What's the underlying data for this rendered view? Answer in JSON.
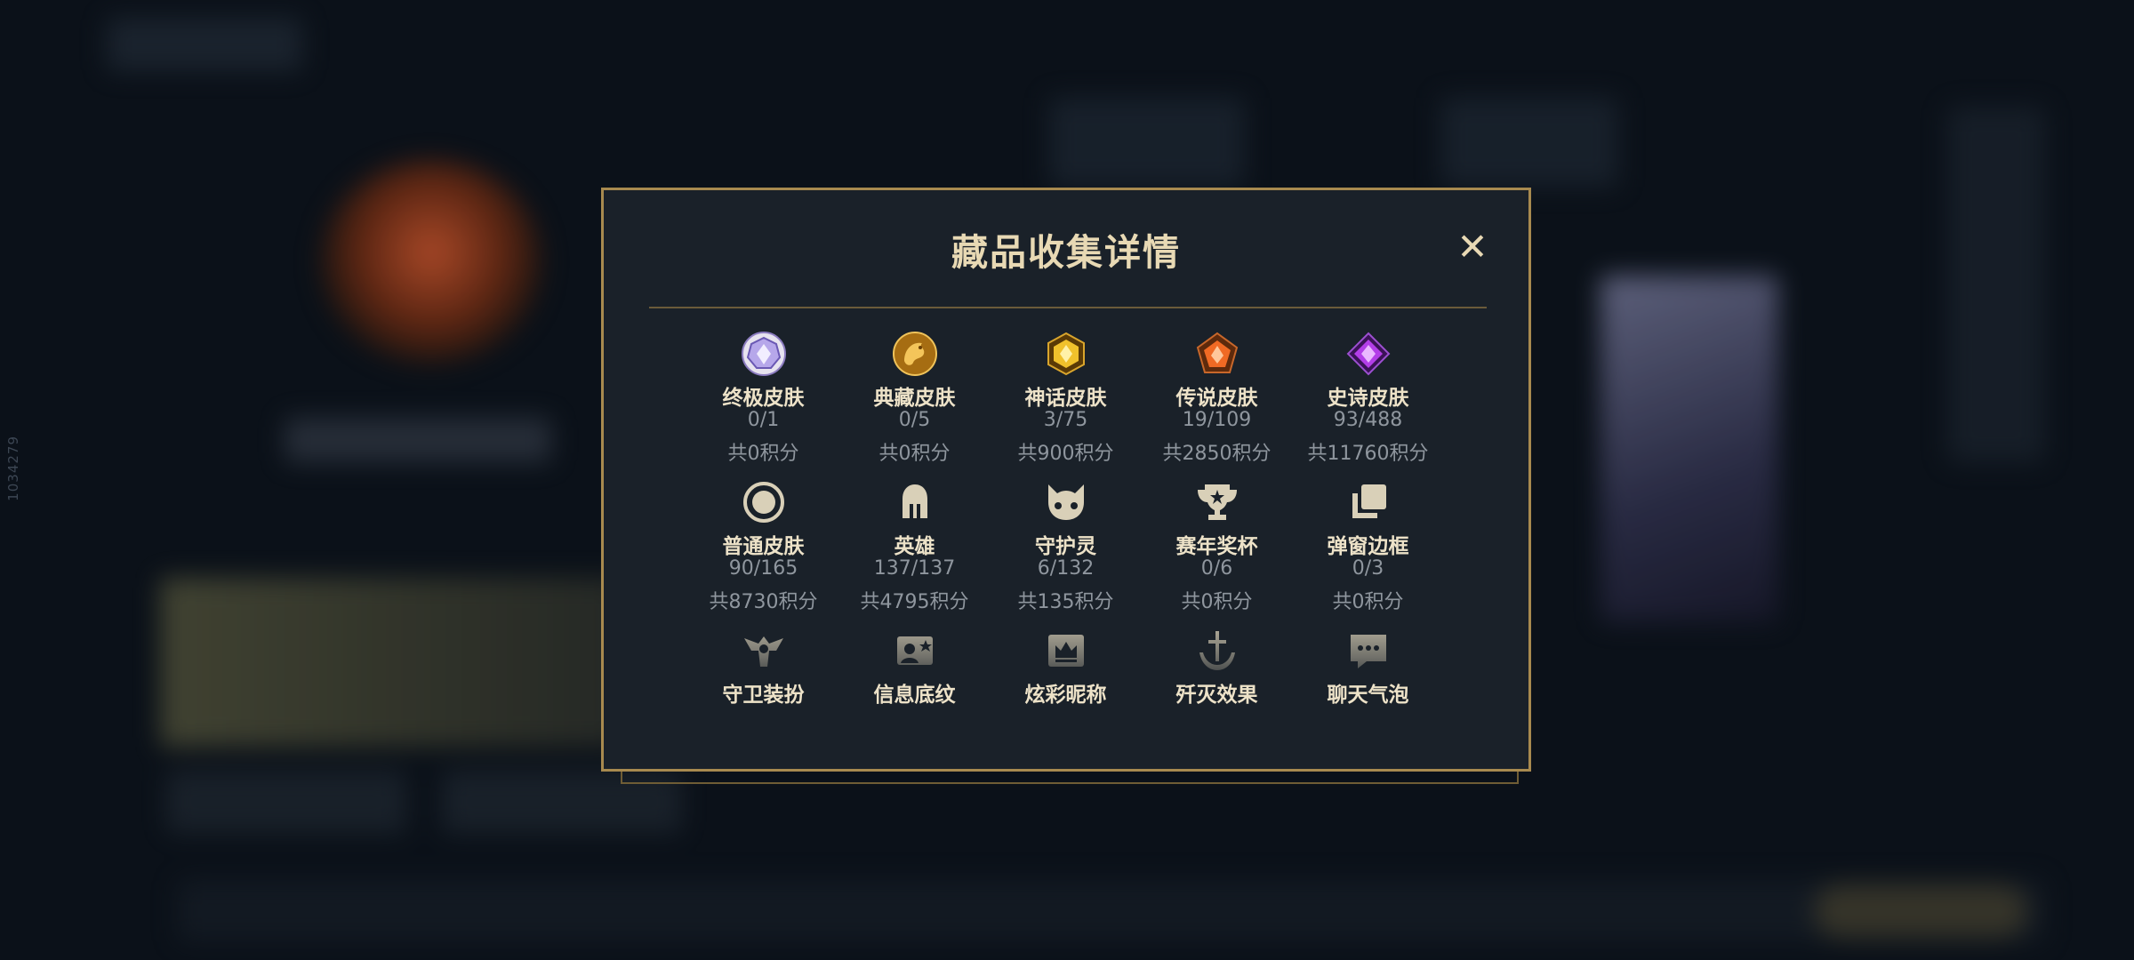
{
  "background": {
    "vertical_text": "1034279"
  },
  "modal": {
    "title": "藏品收集详情",
    "close_icon": "close-icon",
    "items": [
      {
        "label": "终极皮肤",
        "count": "0/1",
        "points": "共0积分",
        "icon": "ultimate-skin-gem-icon"
      },
      {
        "label": "典藏皮肤",
        "count": "0/5",
        "points": "共0积分",
        "icon": "collection-skin-dragon-icon"
      },
      {
        "label": "神话皮肤",
        "count": "3/75",
        "points": "共900积分",
        "icon": "mythic-skin-gem-icon"
      },
      {
        "label": "传说皮肤",
        "count": "19/109",
        "points": "共2850积分",
        "icon": "legendary-skin-gem-icon"
      },
      {
        "label": "史诗皮肤",
        "count": "93/488",
        "points": "共11760积分",
        "icon": "epic-skin-gem-icon"
      },
      {
        "label": "普通皮肤",
        "count": "90/165",
        "points": "共8730积分",
        "icon": "normal-skin-ring-icon"
      },
      {
        "label": "英雄",
        "count": "137/137",
        "points": "共4795积分",
        "icon": "hero-helmet-icon"
      },
      {
        "label": "守护灵",
        "count": "6/132",
        "points": "共135积分",
        "icon": "guardian-spirit-icon"
      },
      {
        "label": "赛年奖杯",
        "count": "0/6",
        "points": "共0积分",
        "icon": "trophy-icon"
      },
      {
        "label": "弹窗边框",
        "count": "0/3",
        "points": "共0积分",
        "icon": "popup-frame-icon"
      },
      {
        "label": "守卫装扮",
        "icon": "ward-skin-icon"
      },
      {
        "label": "信息底纹",
        "icon": "info-card-icon"
      },
      {
        "label": "炫彩昵称",
        "icon": "colored-nickname-icon"
      },
      {
        "label": "歼灭效果",
        "icon": "elimination-effect-icon"
      },
      {
        "label": "聊天气泡",
        "icon": "chat-bubble-icon"
      }
    ]
  }
}
